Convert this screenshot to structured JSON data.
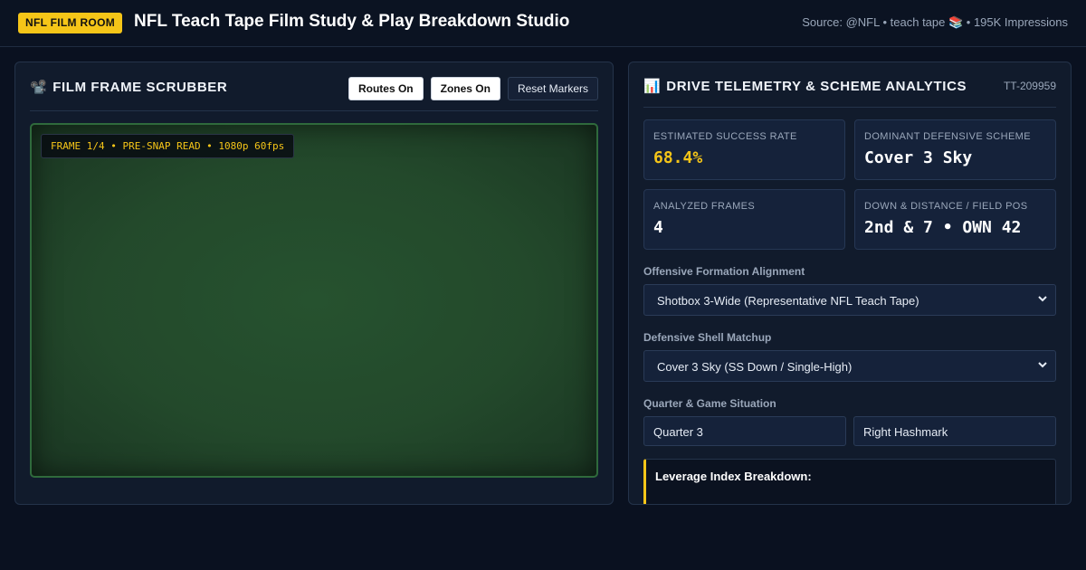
{
  "header": {
    "badge": "NFL FILM ROOM",
    "title": "NFL Teach Tape Film Study & Play Breakdown Studio",
    "source": "Source: @NFL • teach tape 📚 • 195K Impressions"
  },
  "film_panel": {
    "icon": "📽️",
    "title": "FILM FRAME SCRUBBER",
    "buttons": {
      "routes": "Routes On",
      "zones": "Zones On",
      "reset": "Reset Markers"
    },
    "frame_label": "FRAME 1/4 • PRE-SNAP READ • 1080p 60fps"
  },
  "analytics_panel": {
    "icon": "📊",
    "title": "DRIVE TELEMETRY & SCHEME ANALYTICS",
    "tag_id": "TT-209959",
    "stats": [
      {
        "label": "ESTIMATED SUCCESS RATE",
        "value": "68.4%"
      },
      {
        "label": "DOMINANT DEFENSIVE SCHEME",
        "value": "Cover 3 Sky"
      },
      {
        "label": "ANALYZED FRAMES",
        "value": "4"
      },
      {
        "label": "DOWN & DISTANCE / FIELD POS",
        "value": "2nd & 7 • OWN 42"
      }
    ],
    "formation_label": "Offensive Formation Alignment",
    "formation_value": "Shotbox 3-Wide (Representative NFL Teach Tape)",
    "shell_label": "Defensive Shell Matchup",
    "shell_value": "Cover 3 Sky (SS Down / Single-High)",
    "situation_label": "Quarter & Game Situation",
    "quarter_value": "Quarter 3",
    "hash_value": "Right Hashmark",
    "leverage_title": "Leverage Index Breakdown:"
  },
  "colors": {
    "accent": "#f5c518",
    "background": "#0a1120",
    "panel": "#111b2c",
    "field_green": "#23492b"
  }
}
